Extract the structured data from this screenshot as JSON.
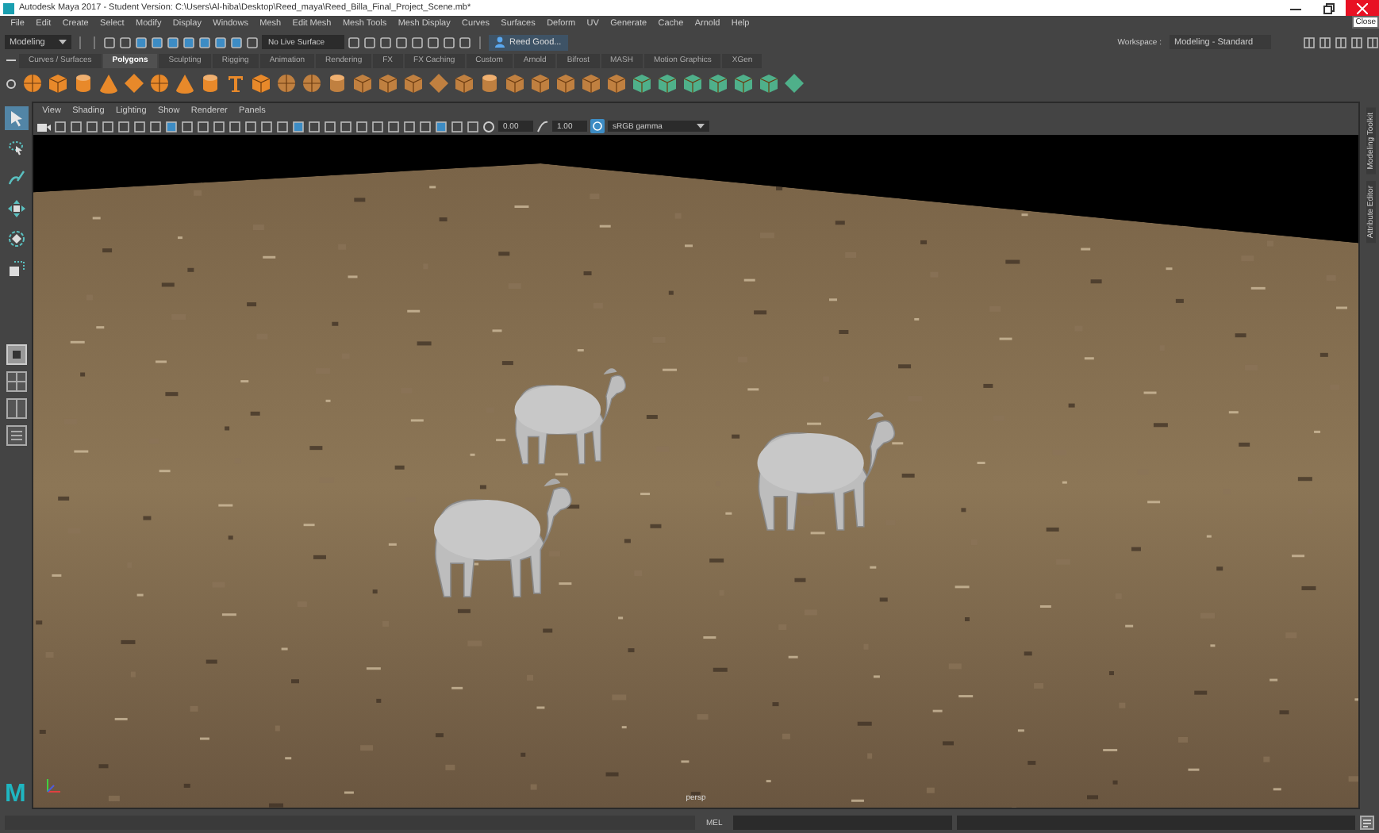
{
  "window": {
    "title": "Autodesk Maya 2017 - Student Version: C:\\Users\\Al-hiba\\Desktop\\Reed_maya\\Reed_Billa_Final_Project_Scene.mb*",
    "tooltip": "Close"
  },
  "menus": [
    "File",
    "Edit",
    "Create",
    "Select",
    "Modify",
    "Display",
    "Windows",
    "Mesh",
    "Edit Mesh",
    "Mesh Tools",
    "Mesh Display",
    "Curves",
    "Surfaces",
    "Deform",
    "UV",
    "Generate",
    "Cache",
    "Arnold",
    "Help"
  ],
  "status_line": {
    "mode": "Modeling",
    "live_surface": "No Live Surface",
    "account": "Reed Good...",
    "workspace_label": "Workspace :",
    "workspace": "Modeling - Standard"
  },
  "shelf_tabs": [
    {
      "label": "Curves / Surfaces",
      "selected": false
    },
    {
      "label": "Polygons",
      "selected": true
    },
    {
      "label": "Sculpting",
      "selected": false
    },
    {
      "label": "Rigging",
      "selected": false
    },
    {
      "label": "Animation",
      "selected": false
    },
    {
      "label": "Rendering",
      "selected": false
    },
    {
      "label": "FX",
      "selected": false
    },
    {
      "label": "FX Caching",
      "selected": false
    },
    {
      "label": "Custom",
      "selected": false
    },
    {
      "label": "Arnold",
      "selected": false
    },
    {
      "label": "Bifrost",
      "selected": false
    },
    {
      "label": "MASH",
      "selected": false
    },
    {
      "label": "Motion Graphics",
      "selected": false
    },
    {
      "label": "XGen",
      "selected": false
    }
  ],
  "tools": [
    {
      "kind": "select",
      "selected": true
    },
    {
      "kind": "lasso",
      "selected": false
    },
    {
      "kind": "paint",
      "selected": false
    },
    {
      "kind": "move",
      "selected": false
    },
    {
      "kind": "rotate",
      "selected": false
    },
    {
      "kind": "scale",
      "selected": false
    }
  ],
  "viewport": {
    "menus": [
      "View",
      "Shading",
      "Lighting",
      "Show",
      "Renderer",
      "Panels"
    ],
    "exposure": "0.00",
    "gamma": "1.00",
    "color_space": "sRGB gamma",
    "camera": "persp"
  },
  "logo": "M",
  "side_tabs": [
    "Modeling Toolkit",
    "Attribute Editor"
  ],
  "command_line": {
    "language": "MEL"
  }
}
